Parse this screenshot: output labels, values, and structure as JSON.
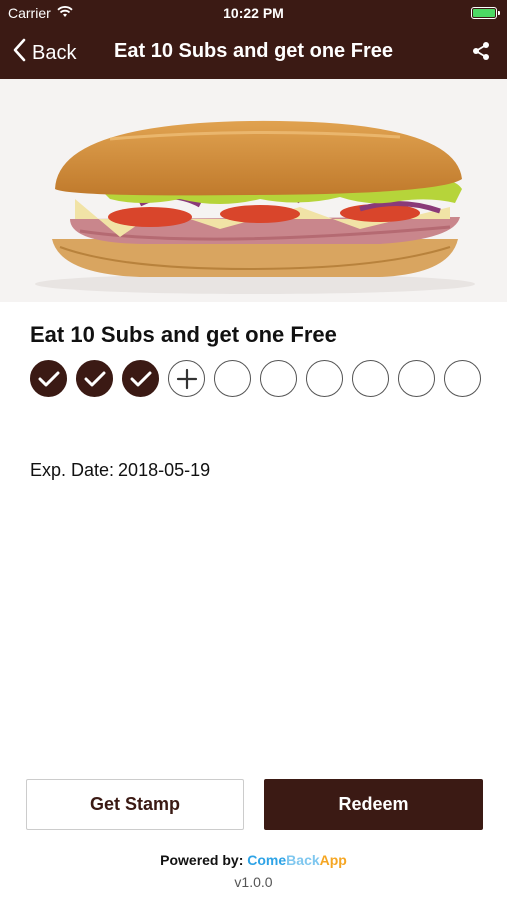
{
  "status_bar": {
    "carrier": "Carrier",
    "time": "10:22 PM"
  },
  "nav": {
    "back_label": "Back",
    "title": "Eat 10 Subs and get one Free"
  },
  "card": {
    "title": "Eat 10 Subs and get one Free",
    "stamps_total": 10,
    "stamps_collected": 3,
    "exp_label": "Exp. Date:",
    "exp_value": "2018-05-19"
  },
  "buttons": {
    "get_stamp": "Get Stamp",
    "redeem": "Redeem"
  },
  "footer": {
    "powered_label": "Powered by:",
    "brand_part1": "Come",
    "brand_part2": "Back",
    "brand_part3": "App",
    "version": "v1.0.0"
  },
  "colors": {
    "primary": "#3b1a14",
    "battery": "#4cd964"
  }
}
